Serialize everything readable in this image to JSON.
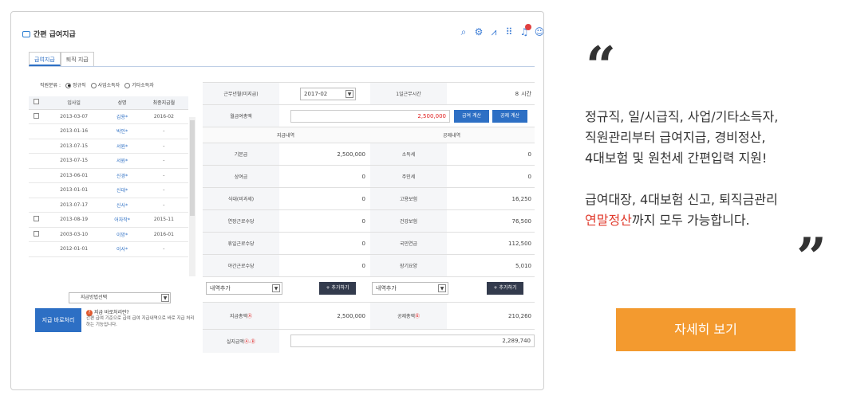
{
  "app": {
    "title": "간편 급여지급"
  },
  "tabs": [
    {
      "label": "급여지급"
    },
    {
      "label": "퇴직 지급"
    }
  ],
  "employee_filter": {
    "label": "직원분류 :",
    "options": [
      "정규직",
      "사업소득자",
      "기타소득자"
    ],
    "selected": "정규직"
  },
  "employee_table": {
    "headers": [
      "입사일",
      "성명",
      "최종지급월"
    ],
    "rows": [
      {
        "checkbox": true,
        "date": "2013-03-07",
        "name": "김용*",
        "last": "2016-02"
      },
      {
        "checkbox": false,
        "date": "2013-01-16",
        "name": "박인*",
        "last": "-"
      },
      {
        "checkbox": false,
        "date": "2013-07-15",
        "name": "서원*",
        "last": "-"
      },
      {
        "checkbox": false,
        "date": "2013-07-15",
        "name": "서원*",
        "last": "-"
      },
      {
        "checkbox": false,
        "date": "2013-06-01",
        "name": "신경*",
        "last": "-"
      },
      {
        "checkbox": false,
        "date": "2013-01-01",
        "name": "신대*",
        "last": "-"
      },
      {
        "checkbox": false,
        "date": "2013-07-17",
        "name": "신사*",
        "last": "-"
      },
      {
        "checkbox": true,
        "date": "2013-08-19",
        "name": "어자작*",
        "last": "2015-11"
      },
      {
        "checkbox": true,
        "date": "2003-03-10",
        "name": "이망*",
        "last": "2016-01"
      },
      {
        "checkbox": false,
        "date": "2012-01-01",
        "name": "이사*",
        "last": "-"
      }
    ]
  },
  "pay_method": {
    "placeholder": "지급방법선택"
  },
  "pay_now": {
    "button": "지급 바로처리",
    "question": "지급 바로처리란?",
    "help": "간편 급여 기준으로 급여 급여 지급내역으로 바로 지급 처리하는 기능입니다."
  },
  "form": {
    "work_month_label": "근무년월(미지급)",
    "work_month_value": "2017-02",
    "daily_hours_label": "1일근무시간",
    "daily_hours_value": "8",
    "daily_hours_unit": "시간",
    "monthly_amount_label": "월급여총액",
    "monthly_amount_value": "2,500,000",
    "calc_pay_button": "급여 계산",
    "calc_deduct_button": "공제 계산",
    "pay_section": "지급내역",
    "deduct_section": "공제내역",
    "pay_items": [
      {
        "label": "기본급",
        "value": "2,500,000"
      },
      {
        "label": "상여금",
        "value": "0"
      },
      {
        "label": "식대(비과세)",
        "value": "0"
      },
      {
        "label": "연장근로수당",
        "value": "0"
      },
      {
        "label": "휴일근로수당",
        "value": "0"
      },
      {
        "label": "야간근로수당",
        "value": "0"
      }
    ],
    "deduct_items": [
      {
        "label": "소득세",
        "value": "0"
      },
      {
        "label": "주민세",
        "value": "0"
      },
      {
        "label": "고용보험",
        "value": "16,250"
      },
      {
        "label": "건강보험",
        "value": "76,500"
      },
      {
        "label": "국민연금",
        "value": "112,500"
      },
      {
        "label": "장기요양",
        "value": "5,010"
      }
    ],
    "add_item_select": "내역추가",
    "add_button": "+ 추가하기",
    "total_pay_label": "지급총액",
    "total_pay_marker": "Ⓐ",
    "total_pay_value": "2,500,000",
    "total_deduct_label": "공제총액",
    "total_deduct_marker": "Ⓑ",
    "total_deduct_value": "210,260",
    "net_pay_label": "실지급액",
    "net_pay_marker": "Ⓐ-Ⓑ",
    "net_pay_value": "2,289,740"
  },
  "promo": {
    "quote_open": "“",
    "quote_close": "”",
    "line1": "정규직, 일/시급직, 사업/기타소득자,",
    "line2": "직원관리부터 급여지급, 경비정산,",
    "line3": "4대보험 및 원천세 간편입력 지원!",
    "line4": "급여대장, 4대보험 신고, 퇴직금관리",
    "line5_highlight": "연말정산",
    "line5_rest": "까지 모두 가능합니다.",
    "cta": "자세히 보기"
  },
  "colors": {
    "accent_blue": "#2d6fc4",
    "cta_orange": "#f39a2f",
    "highlight_red": "#e03a2c"
  }
}
